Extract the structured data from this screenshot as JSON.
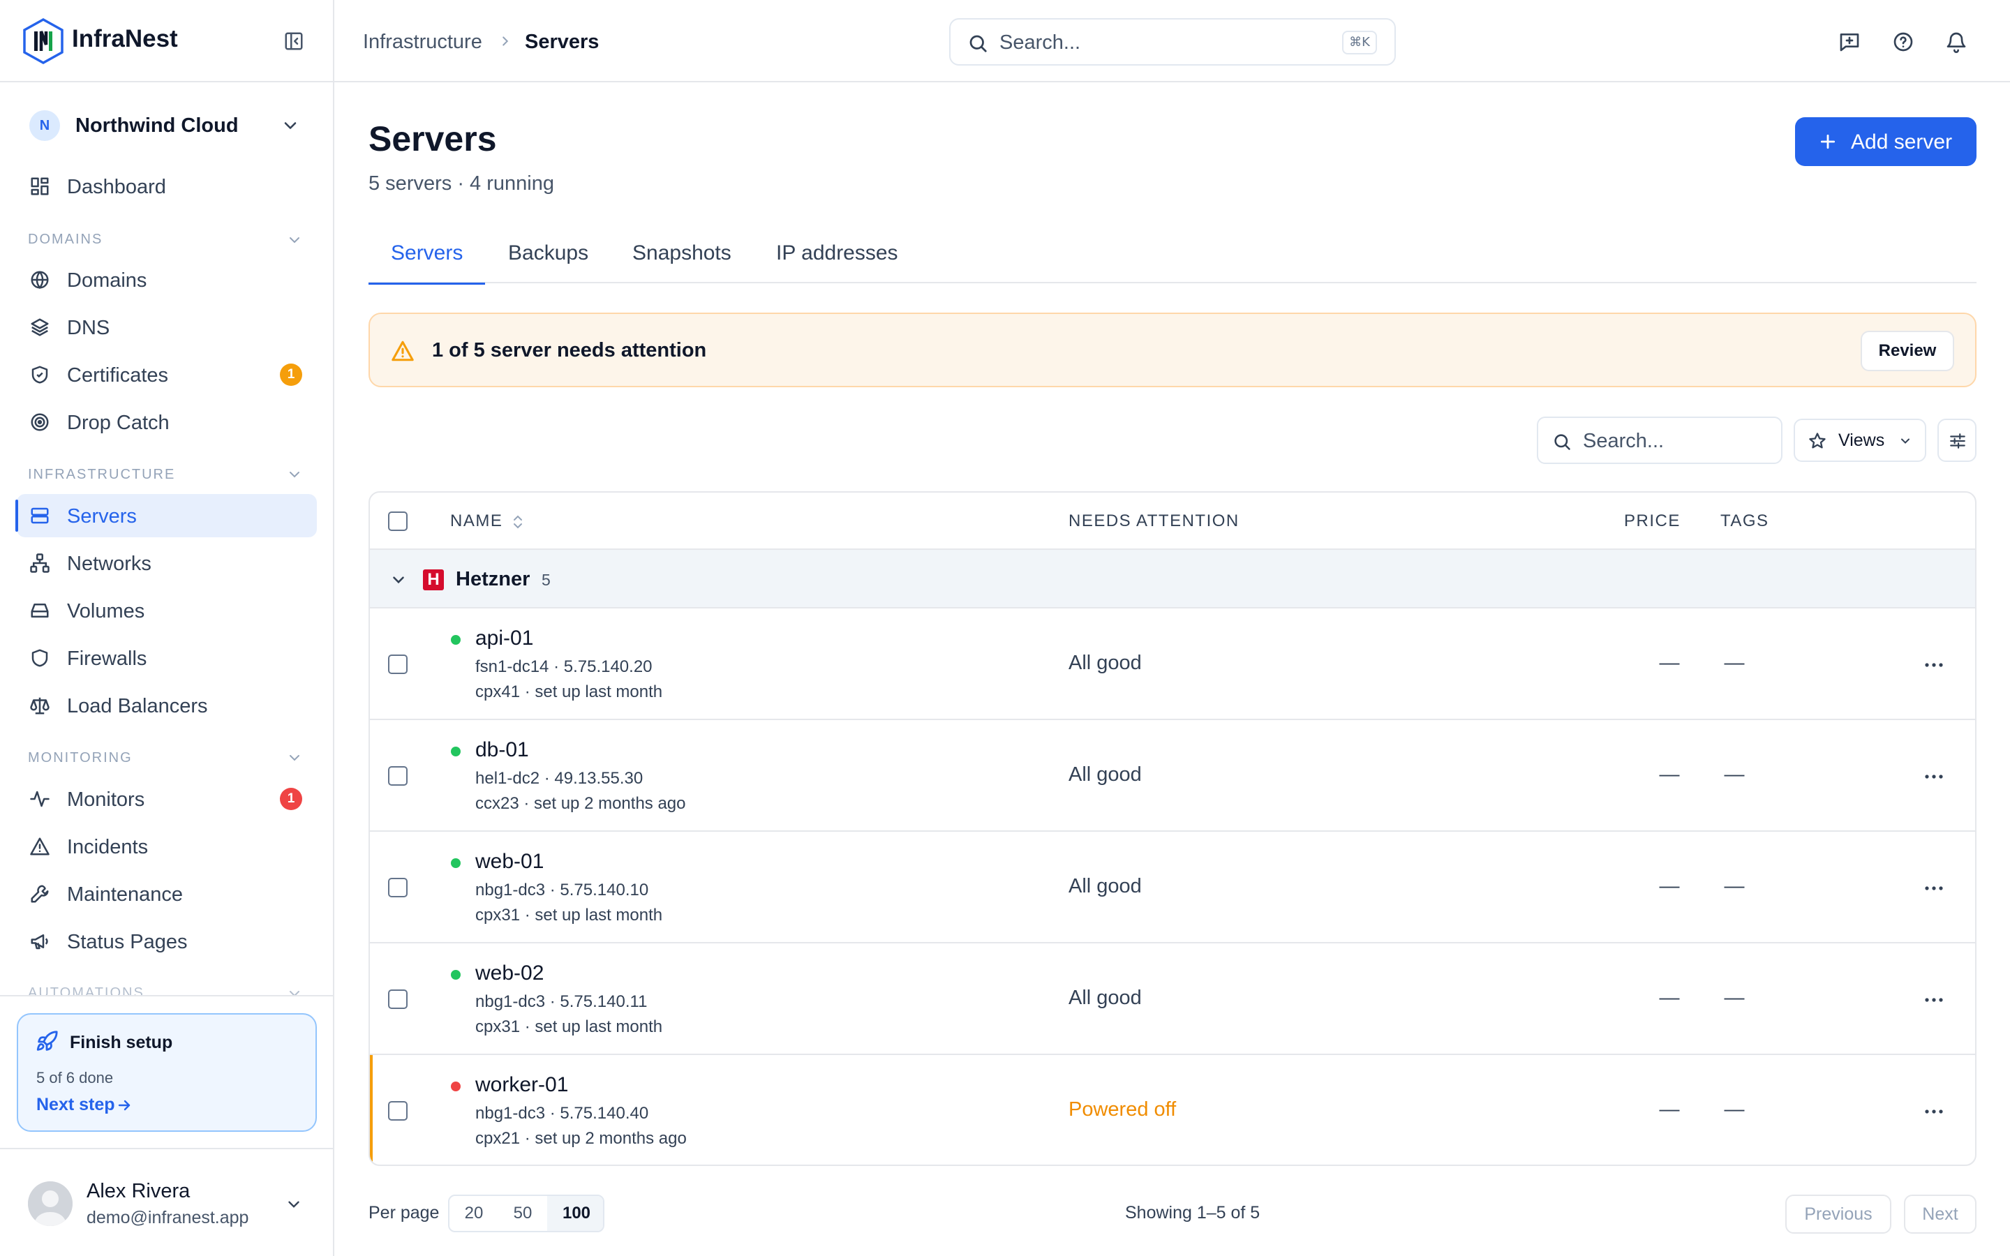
{
  "app": {
    "name": "InfraNest"
  },
  "org": {
    "initial": "N",
    "name": "Northwind Cloud"
  },
  "nav": {
    "dashboard": "Dashboard",
    "sections": {
      "domains": "DOMAINS",
      "infrastructure": "INFRASTRUCTURE",
      "monitoring": "MONITORING",
      "automations": "AUTOMATIONS"
    },
    "domains": "Domains",
    "dns": "DNS",
    "certificates": "Certificates",
    "certificates_badge": "1",
    "drop_catch": "Drop Catch",
    "servers": "Servers",
    "networks": "Networks",
    "volumes": "Volumes",
    "firewalls": "Firewalls",
    "load_balancers": "Load Balancers",
    "monitors": "Monitors",
    "monitors_badge": "1",
    "incidents": "Incidents",
    "maintenance": "Maintenance",
    "status_pages": "Status Pages"
  },
  "setup": {
    "title": "Finish setup",
    "progress": "5 of 6 done",
    "next": "Next step"
  },
  "user": {
    "name": "Alex Rivera",
    "email": "demo@infranest.app"
  },
  "header": {
    "breadcrumb_parent": "Infrastructure",
    "breadcrumb_current": "Servers",
    "search_placeholder": "Search...",
    "search_shortcut": "⌘K"
  },
  "page": {
    "title": "Servers",
    "subtitle": "5 servers · 4 running",
    "add_button": "Add server"
  },
  "tabs": [
    "Servers",
    "Backups",
    "Snapshots",
    "IP addresses"
  ],
  "alert": {
    "message": "1 of 5 server needs attention",
    "action": "Review"
  },
  "toolbar": {
    "search_placeholder": "Search...",
    "views_label": "Views"
  },
  "table": {
    "columns": {
      "name": "NAME",
      "needs_attention": "NEEDS ATTENTION",
      "price": "PRICE",
      "tags": "TAGS"
    },
    "group": {
      "name": "Hetzner",
      "count": "5",
      "logo_letter": "H"
    },
    "rows": [
      {
        "name": "api-01",
        "location": "fsn1-dc14 · 5.75.140.20",
        "meta": "cpx41 · set up last month",
        "status": "All good",
        "price": "—",
        "tags": "—",
        "state_color": "#22c55e"
      },
      {
        "name": "db-01",
        "location": "hel1-dc2 · 49.13.55.30",
        "meta": "ccx23 · set up 2 months ago",
        "status": "All good",
        "price": "—",
        "tags": "—",
        "state_color": "#22c55e"
      },
      {
        "name": "web-01",
        "location": "nbg1-dc3 · 5.75.140.10",
        "meta": "cpx31 · set up last month",
        "status": "All good",
        "price": "—",
        "tags": "—",
        "state_color": "#22c55e"
      },
      {
        "name": "web-02",
        "location": "nbg1-dc3 · 5.75.140.11",
        "meta": "cpx31 · set up last month",
        "status": "All good",
        "price": "—",
        "tags": "—",
        "state_color": "#22c55e"
      },
      {
        "name": "worker-01",
        "location": "nbg1-dc3 · 5.75.140.40",
        "meta": "cpx21 · set up 2 months ago",
        "status": "Powered off",
        "price": "—",
        "tags": "—",
        "state_color": "#ef4444"
      }
    ]
  },
  "pagination": {
    "per_page_label": "Per page",
    "options": [
      "20",
      "50",
      "100"
    ],
    "selected": "100",
    "showing": "Showing 1–5 of 5",
    "previous": "Previous",
    "next": "Next"
  },
  "colors": {
    "accent": "#2563eb",
    "warning": "#f59e0b",
    "danger": "#ef4444",
    "success": "#22c55e"
  }
}
